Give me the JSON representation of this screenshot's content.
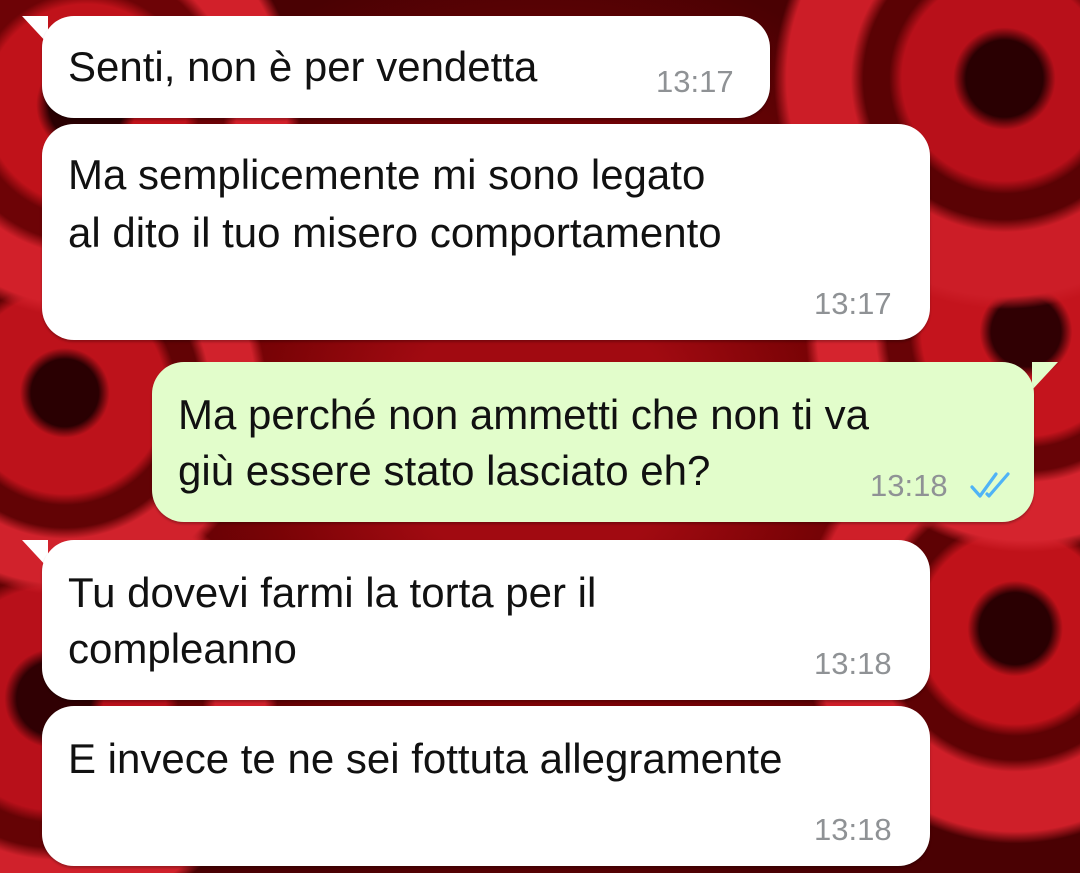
{
  "messages": [
    {
      "direction": "incoming",
      "lines": [
        "Senti, non è per vendetta"
      ],
      "time": "13:17"
    },
    {
      "direction": "incoming",
      "lines": [
        "Ma semplicemente mi sono legato",
        "al dito il tuo misero comportamento"
      ],
      "time": "13:17"
    },
    {
      "direction": "outgoing",
      "lines": [
        "Ma perché non ammetti che non ti va",
        "giù essere stato lasciato eh?"
      ],
      "time": "13:18",
      "status_icon": "double-check-read-icon"
    },
    {
      "direction": "incoming",
      "lines": [
        "Tu dovevi farmi la torta per il",
        "compleanno"
      ],
      "time": "13:18"
    },
    {
      "direction": "incoming",
      "lines": [
        "E invece te ne sei fottuta allegramente"
      ],
      "time": "13:18"
    }
  ],
  "colors": {
    "incoming_bubble": "#ffffff",
    "outgoing_bubble": "#e2fdcb",
    "timestamp": "#8f9295",
    "read_ticks": "#4fb3f6",
    "wallpaper": "#b3121b"
  }
}
